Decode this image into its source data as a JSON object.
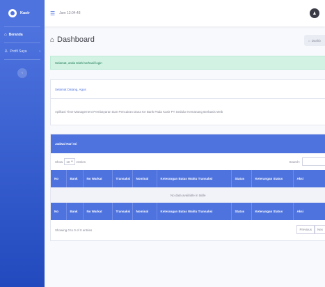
{
  "sidebar": {
    "brand": "Kasir",
    "items": [
      {
        "label": "Beranda"
      },
      {
        "label": "Profil Saya"
      }
    ],
    "toggle": "‹"
  },
  "topbar": {
    "clock": "Jam 13:04:48"
  },
  "page": {
    "title": "Dashboard",
    "dash_button": "Dashb"
  },
  "alert": {
    "text": "Selamat, anda telah berhasil login"
  },
  "welcome": {
    "header": "Selamat Datang, Agus",
    "body": "Aplikasi Time Management Pembayaran Dan Pencairan Dana Ke Bank Pada Kasir PT Sedulur Kemanang Berbasis Web"
  },
  "schedule": {
    "header": "Jadwal Hari Ini",
    "show_label": "Show",
    "entries_value": "10",
    "entries_label": "entries",
    "search_label": "Search:",
    "columns": [
      "No",
      "Bank",
      "No Warkat",
      "Transaksi",
      "Nominal",
      "Keterangan Batas Waktu Transaksi",
      "Status",
      "Keterangan Status",
      "Aksi"
    ],
    "empty_text": "No data available in table",
    "info": "Showing 0 to 0 of 0 entries",
    "prev": "Previous",
    "next": "Nex"
  }
}
